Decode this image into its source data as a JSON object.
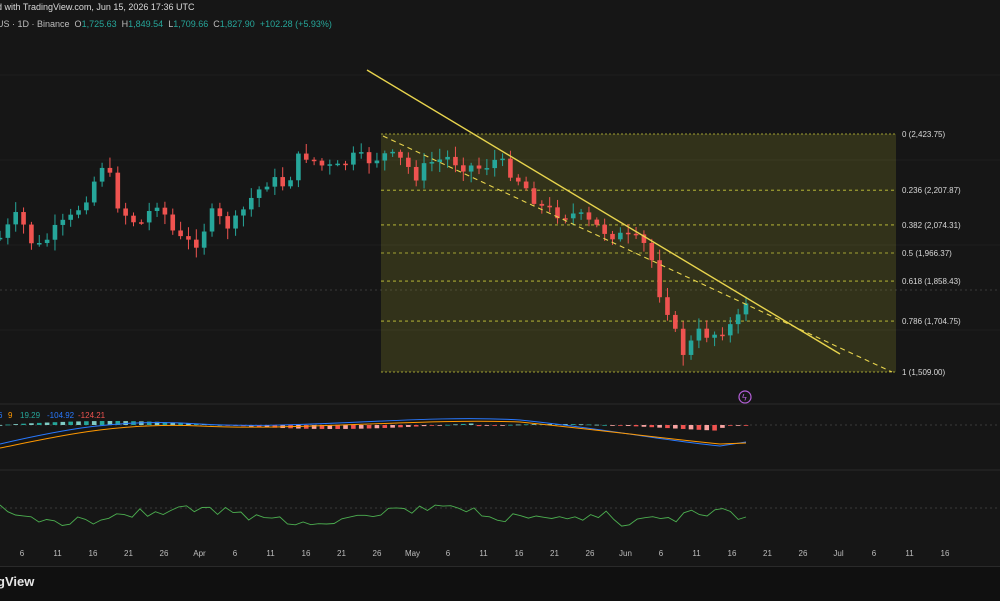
{
  "header": {
    "title": "d with TradingView.com, Jun 15, 2026 17:36 UTC",
    "symbol": "US · 1D · Binance",
    "open_label": "O",
    "open": "1,725.63",
    "high_label": "H",
    "high": "1,849.54",
    "low_label": "L",
    "low": "1,709.66",
    "close_label": "C",
    "close": "1,827.90",
    "change": "+102.28 (+5.93%)"
  },
  "brand": "gView",
  "colors": {
    "up": "#26a69a",
    "down": "#ef5350",
    "fib": "#c9c93a",
    "trend": "#e8d44d"
  },
  "chart_data": {
    "type": "candlestick",
    "fib_levels": [
      {
        "ratio": 0,
        "price": 2423.75,
        "label": "0 (2,423.75)"
      },
      {
        "ratio": 0.236,
        "price": 2207.87,
        "label": "0.236 (2,207.87)"
      },
      {
        "ratio": 0.382,
        "price": 2074.31,
        "label": "0.382 (2,074.31)"
      },
      {
        "ratio": 0.5,
        "price": 1966.37,
        "label": "0.5 (1,966.37)"
      },
      {
        "ratio": 0.618,
        "price": 1858.43,
        "label": "0.618 (1,858.43)"
      },
      {
        "ratio": 0.786,
        "price": 1704.75,
        "label": "0.786 (1,704.75)"
      },
      {
        "ratio": 1,
        "price": 1509.0,
        "label": "1 (1,509.00)"
      }
    ],
    "x_ticks": [
      "6",
      "11",
      "16",
      "21",
      "26",
      "Apr",
      "6",
      "11",
      "16",
      "21",
      "26",
      "May",
      "6",
      "11",
      "16",
      "21",
      "26",
      "Jun",
      "6",
      "11",
      "16",
      "21",
      "26",
      "Jul",
      "6",
      "11",
      "16"
    ],
    "indicator_values": [
      "6",
      "9",
      "19.29",
      "-104.92",
      "-124.21"
    ]
  }
}
